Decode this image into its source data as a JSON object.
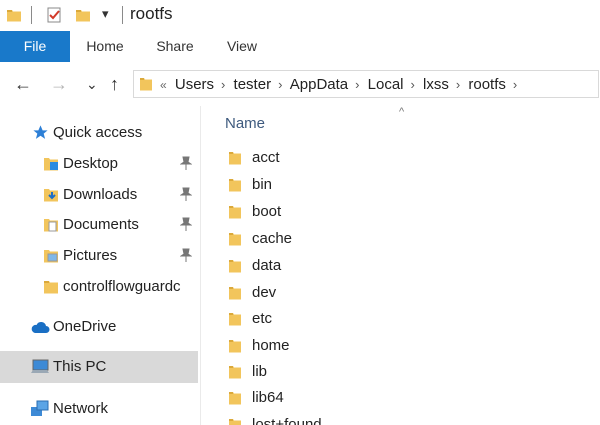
{
  "window": {
    "title": "rootfs",
    "quick_access_dropdown": "▾"
  },
  "ribbon": {
    "tabs": [
      {
        "label": "File",
        "active": true
      },
      {
        "label": "Home"
      },
      {
        "label": "Share"
      },
      {
        "label": "View"
      }
    ]
  },
  "nav": {
    "back": "←",
    "forward": "→",
    "recent": "⌄",
    "up": "↑"
  },
  "address": {
    "overflow": "«",
    "separator": "›",
    "breadcrumbs": [
      "Users",
      "tester",
      "AppData",
      "Local",
      "lxss",
      "rootfs"
    ]
  },
  "navpane": {
    "quick_access": "Quick access",
    "items": [
      {
        "label": "Desktop",
        "icon": "desktop-folder-icon",
        "pinned": true
      },
      {
        "label": "Downloads",
        "icon": "downloads-folder-icon",
        "pinned": true
      },
      {
        "label": "Documents",
        "icon": "documents-folder-icon",
        "pinned": true
      },
      {
        "label": "Pictures",
        "icon": "pictures-folder-icon",
        "pinned": true
      },
      {
        "label": "controlflowguardc",
        "icon": "folder-icon",
        "pinned": false
      }
    ],
    "onedrive": "OneDrive",
    "thispc": "This PC",
    "network": "Network"
  },
  "filelist": {
    "sort_indicator": "^",
    "column_name": "Name",
    "files": [
      "acct",
      "bin",
      "boot",
      "cache",
      "data",
      "dev",
      "etc",
      "home",
      "lib",
      "lib64",
      "lost+found"
    ]
  },
  "colors": {
    "accent": "#1979ca",
    "folder_yellow": "#f2c55c",
    "folder_dark": "#dba93b",
    "selected": "#d9d9d9"
  }
}
